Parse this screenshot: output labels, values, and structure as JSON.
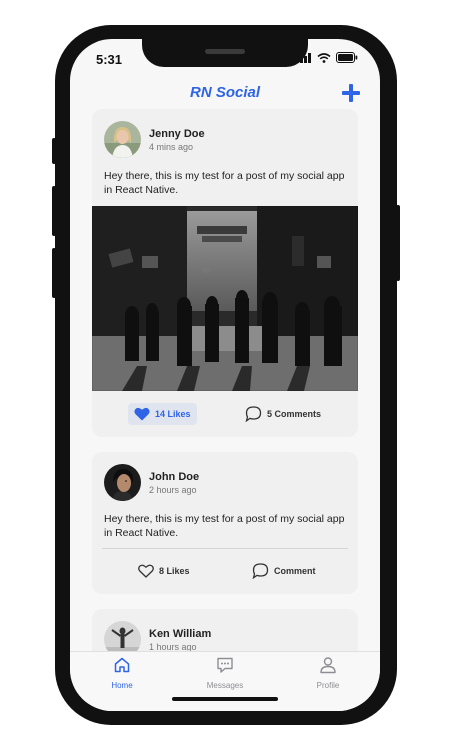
{
  "status_bar": {
    "time": "5:31"
  },
  "header": {
    "title": "RN Social",
    "add_icon": "plus-icon"
  },
  "posts": [
    {
      "user_name": "Jenny Doe",
      "time": "4 mins ago",
      "text": "Hey there, this is my test for a post of my social app in React Native.",
      "has_image": true,
      "likes_label": "14 Likes",
      "liked": true,
      "comments_label": "5 Comments"
    },
    {
      "user_name": "John Doe",
      "time": "2 hours ago",
      "text": "Hey there, this is my test for a post of my social app in React Native.",
      "has_image": false,
      "likes_label": "8 Likes",
      "liked": false,
      "comments_label": "Comment"
    },
    {
      "user_name": "Ken William",
      "time": "1 hours ago"
    }
  ],
  "tabs": [
    {
      "label": "Home",
      "icon": "home-icon",
      "active": true
    },
    {
      "label": "Messages",
      "icon": "chat-icon",
      "active": false
    },
    {
      "label": "Profile",
      "icon": "person-icon",
      "active": false
    }
  ],
  "colors": {
    "accent": "#2e64e5",
    "card": "#f0f0f0",
    "background": "#f7f7f7"
  }
}
